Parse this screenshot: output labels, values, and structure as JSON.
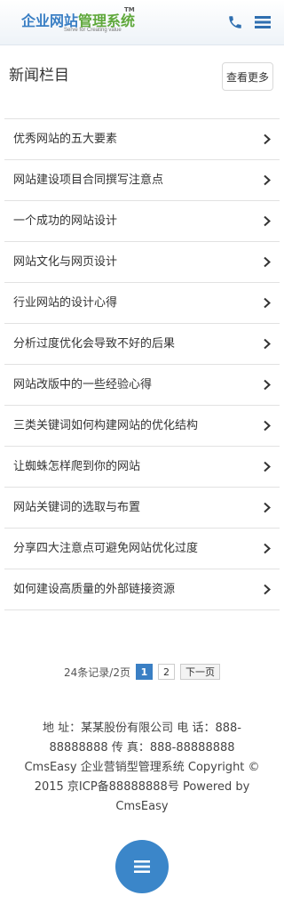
{
  "header": {
    "logo": {
      "part1": "企业网站",
      "part2": "管理系统",
      "tm": "TM",
      "tagline": "Serve for Creating value"
    },
    "icons": [
      "phone-icon",
      "menu-icon"
    ],
    "colors": {
      "brand_blue": "#3a7fc4",
      "brand_green": "#5fa83b"
    }
  },
  "section": {
    "title": "新闻栏目",
    "more_label": "查看更多"
  },
  "news": [
    {
      "title": "优秀网站的五大要素"
    },
    {
      "title": "网站建设项目合同撰写注意点"
    },
    {
      "title": "一个成功的网站设计"
    },
    {
      "title": "网站文化与网页设计"
    },
    {
      "title": "行业网站的设计心得"
    },
    {
      "title": "分析过度优化会导致不好的后果"
    },
    {
      "title": "网站改版中的一些经验心得"
    },
    {
      "title": "三类关键词如何构建网站的优化结构"
    },
    {
      "title": "让蜘蛛怎样爬到你的网站"
    },
    {
      "title": "网站关键词的选取与布置"
    },
    {
      "title": "分享四大注意点可避免网站优化过度"
    },
    {
      "title": "如何建设高质量的外部链接资源"
    }
  ],
  "pagination": {
    "summary": "24条记录/2页",
    "pages": [
      "1",
      "2"
    ],
    "current": "1",
    "next_label": "下一页"
  },
  "footer": {
    "line1": "地 址：某某股份有限公司  电 话：888-88888888  传 真：888-88888888",
    "line2": "CmsEasy 企业营销型管理系统 Copyright © 2015  京ICP备88888888号  Powered by CmsEasy"
  },
  "fab": {
    "icon": "menu-icon",
    "color": "#3b86c9"
  }
}
